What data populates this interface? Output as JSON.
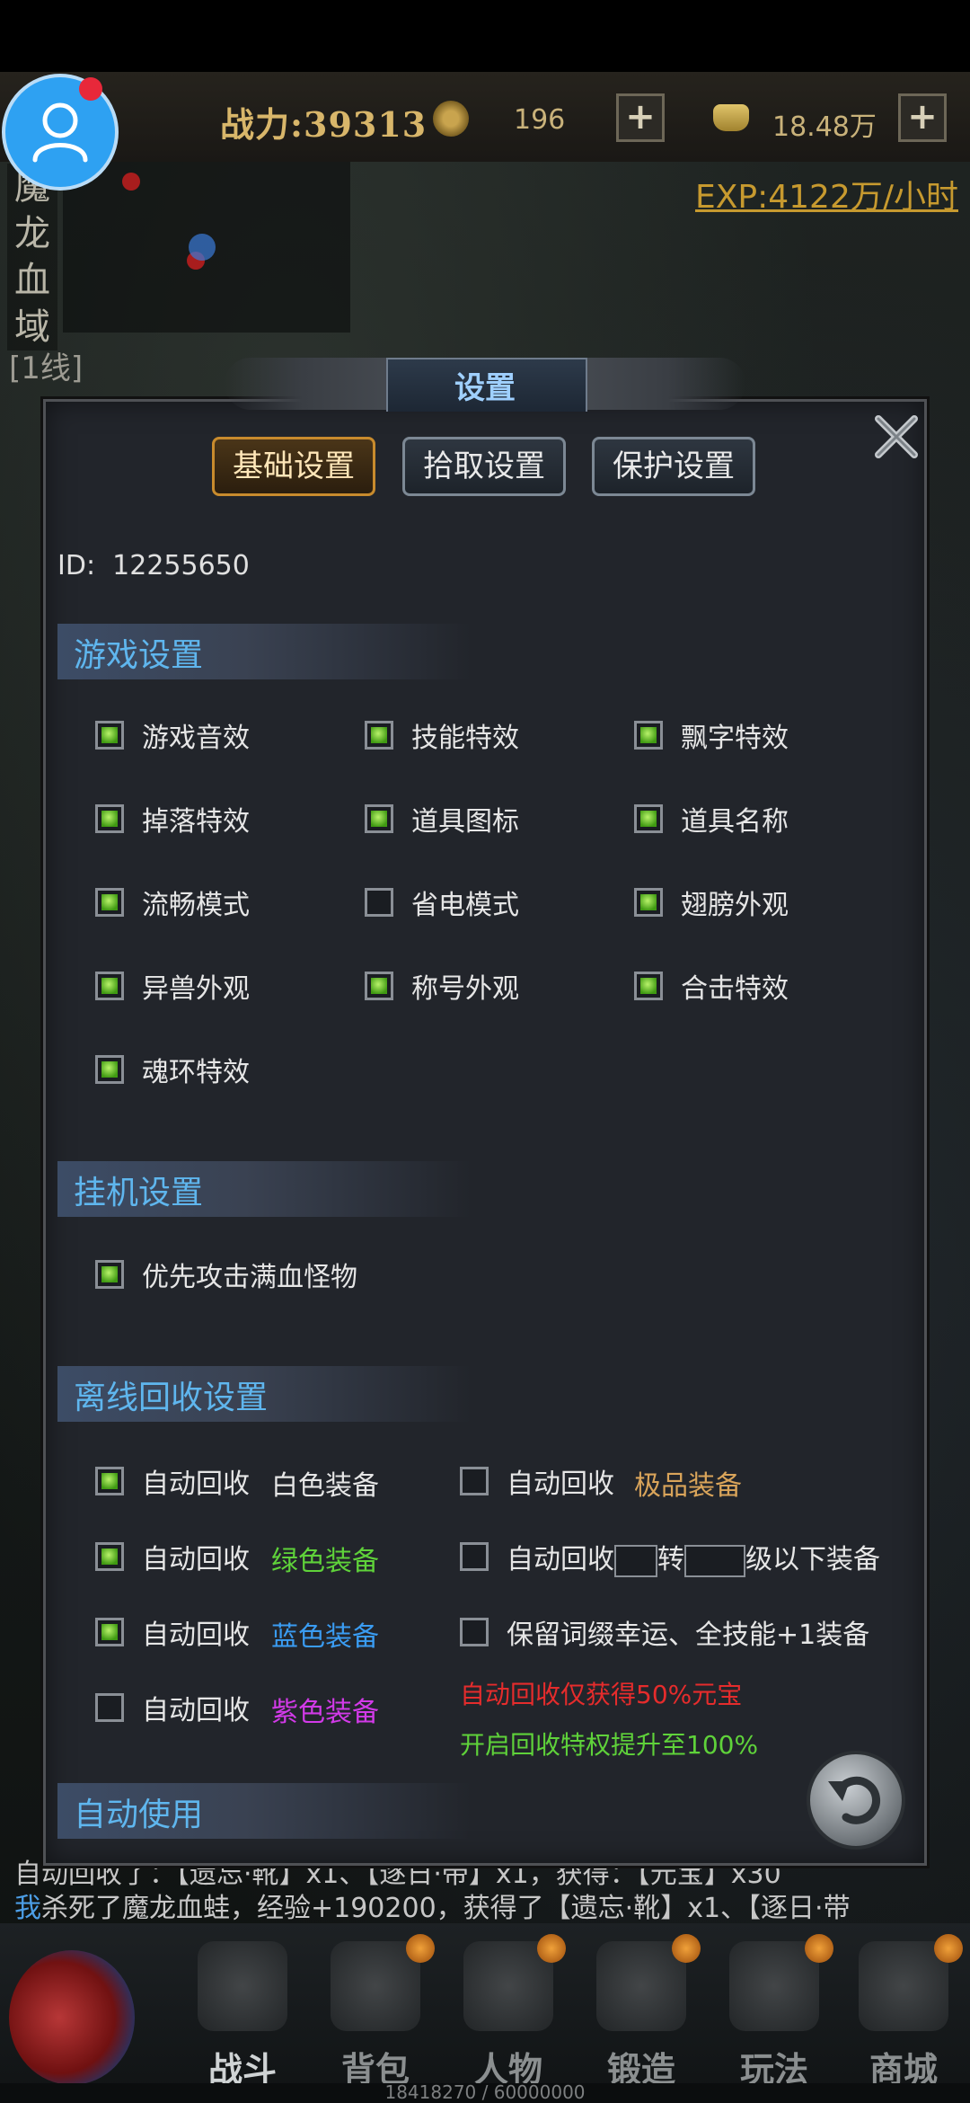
{
  "hud": {
    "power": "战力:39313",
    "coins": "196",
    "gold": "18.48万",
    "exp_rate": "EXP:4122万/小时",
    "map_name": [
      "魔",
      "龙",
      "血",
      "域"
    ],
    "line": "[1线]"
  },
  "dialog": {
    "title": "设置",
    "tabs": [
      {
        "label": "基础设置",
        "active": true
      },
      {
        "label": "拾取设置",
        "active": false
      },
      {
        "label": "保护设置",
        "active": false
      }
    ],
    "id_label": "ID:",
    "id_value": "12255650",
    "game_settings": {
      "title": "游戏设置",
      "options": [
        {
          "label": "游戏音效",
          "checked": true
        },
        {
          "label": "技能特效",
          "checked": true
        },
        {
          "label": "飘字特效",
          "checked": true
        },
        {
          "label": "掉落特效",
          "checked": true
        },
        {
          "label": "道具图标",
          "checked": true
        },
        {
          "label": "道具名称",
          "checked": true
        },
        {
          "label": "流畅模式",
          "checked": true
        },
        {
          "label": "省电模式",
          "checked": false
        },
        {
          "label": "翅膀外观",
          "checked": true
        },
        {
          "label": "异兽外观",
          "checked": true
        },
        {
          "label": "称号外观",
          "checked": true
        },
        {
          "label": "合击特效",
          "checked": true
        },
        {
          "label": "魂环特效",
          "checked": true
        }
      ]
    },
    "idle_settings": {
      "title": "挂机设置",
      "options": [
        {
          "label": "优先攻击满血怪物",
          "checked": true
        }
      ]
    },
    "recycle_settings": {
      "title": "离线回收设置",
      "prefix": "自动回收",
      "left": [
        {
          "quality": "白色装备",
          "color": "#e6e6e6",
          "checked": true
        },
        {
          "quality": "绿色装备",
          "color": "#5fd23a",
          "checked": true
        },
        {
          "quality": "蓝色装备",
          "color": "#3a9cf2",
          "checked": true
        },
        {
          "quality": "紫色装备",
          "color": "#d23ae8",
          "checked": false
        }
      ],
      "right_best": {
        "quality": "极品装备",
        "color": "#d9a45a",
        "checked": false
      },
      "right_level": {
        "mid": "转",
        "suffix": "级以下装备",
        "checked": false
      },
      "right_keep": {
        "label": "保留词缀幸运、全技能+1装备",
        "checked": false
      },
      "note_red": "自动回收仅获得50%元宝",
      "note_green": "开启回收特权提升至100%"
    },
    "auto_use": {
      "title": "自动使用"
    }
  },
  "chat": {
    "line_last_prefix": "我",
    "line_last": "杀死了魔龙血蛙，经验+190200，获得了【遗忘·靴】x1、【逐日·带",
    "line_prev": "自动回收了：【遗忘·靴】x1、【逐日·带】x1，获得：【元宝】x30"
  },
  "nav": [
    {
      "label": "战斗",
      "active": true
    },
    {
      "label": "背包",
      "active": false
    },
    {
      "label": "人物",
      "active": false
    },
    {
      "label": "锻造",
      "active": false
    },
    {
      "label": "玩法",
      "active": false
    },
    {
      "label": "商城",
      "active": false
    }
  ],
  "exp_progress": "18418270 / 60000000",
  "colors": {
    "accent_blue": "#5fb6ee",
    "checkbox_green": "#3f9a12",
    "tab_active": "#c88b2d"
  }
}
